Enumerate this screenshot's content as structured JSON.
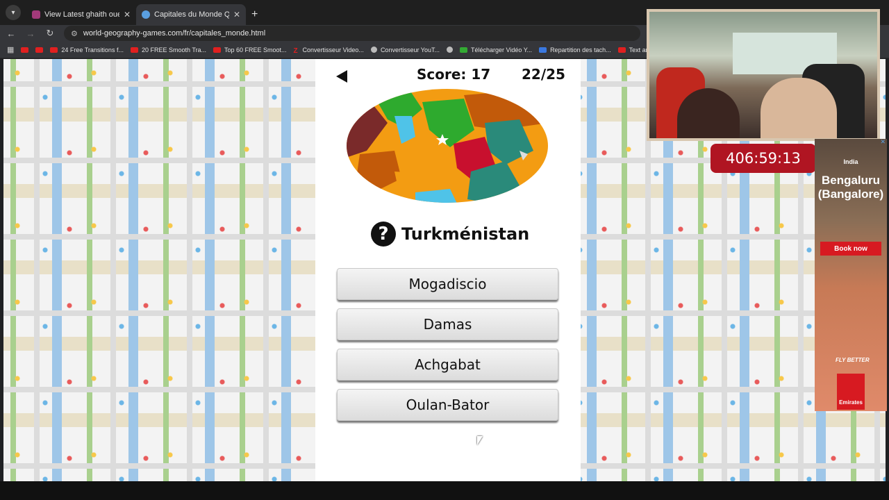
{
  "browser": {
    "tabs": [
      {
        "title": "View Latest ghaith ouerdiane b",
        "favicon_color": "#a23a7a",
        "active": false
      },
      {
        "title": "Capitales du Monde Quiz - Jeu",
        "favicon_color": "#5a9fe0",
        "active": true
      }
    ],
    "new_tab": "+",
    "url": "world-geography-games.com/fr/capitales_monde.html",
    "bookmarks": [
      "24 Free Transitions f...",
      "20 FREE Smooth Tra...",
      "Top 60 FREE Smoot...",
      "Convertisseur Video...",
      "Convertisseur YouT...",
      "Télécharger Vidéo Y...",
      "Repartition des tach...",
      "Text and Image ani..."
    ]
  },
  "game": {
    "score_label": "Score: 17",
    "progress_label": "22/25",
    "question_icon": "?",
    "country": "Turkménistan",
    "answers": [
      "Mogadiscio",
      "Damas",
      "Achgabat",
      "Oulan-Bator"
    ]
  },
  "overlay": {
    "timer": "406:59:13"
  },
  "ad": {
    "country": "India",
    "city": "Bengaluru (Bangalore)",
    "cta": "Book now",
    "tagline": "FLY BETTER",
    "brand": "Emirates"
  },
  "colors": {
    "timer_bg": "#b01522",
    "highlight_country": "#c8102e",
    "target_country": "#2eaa2e",
    "ad_red": "#d71a21"
  }
}
